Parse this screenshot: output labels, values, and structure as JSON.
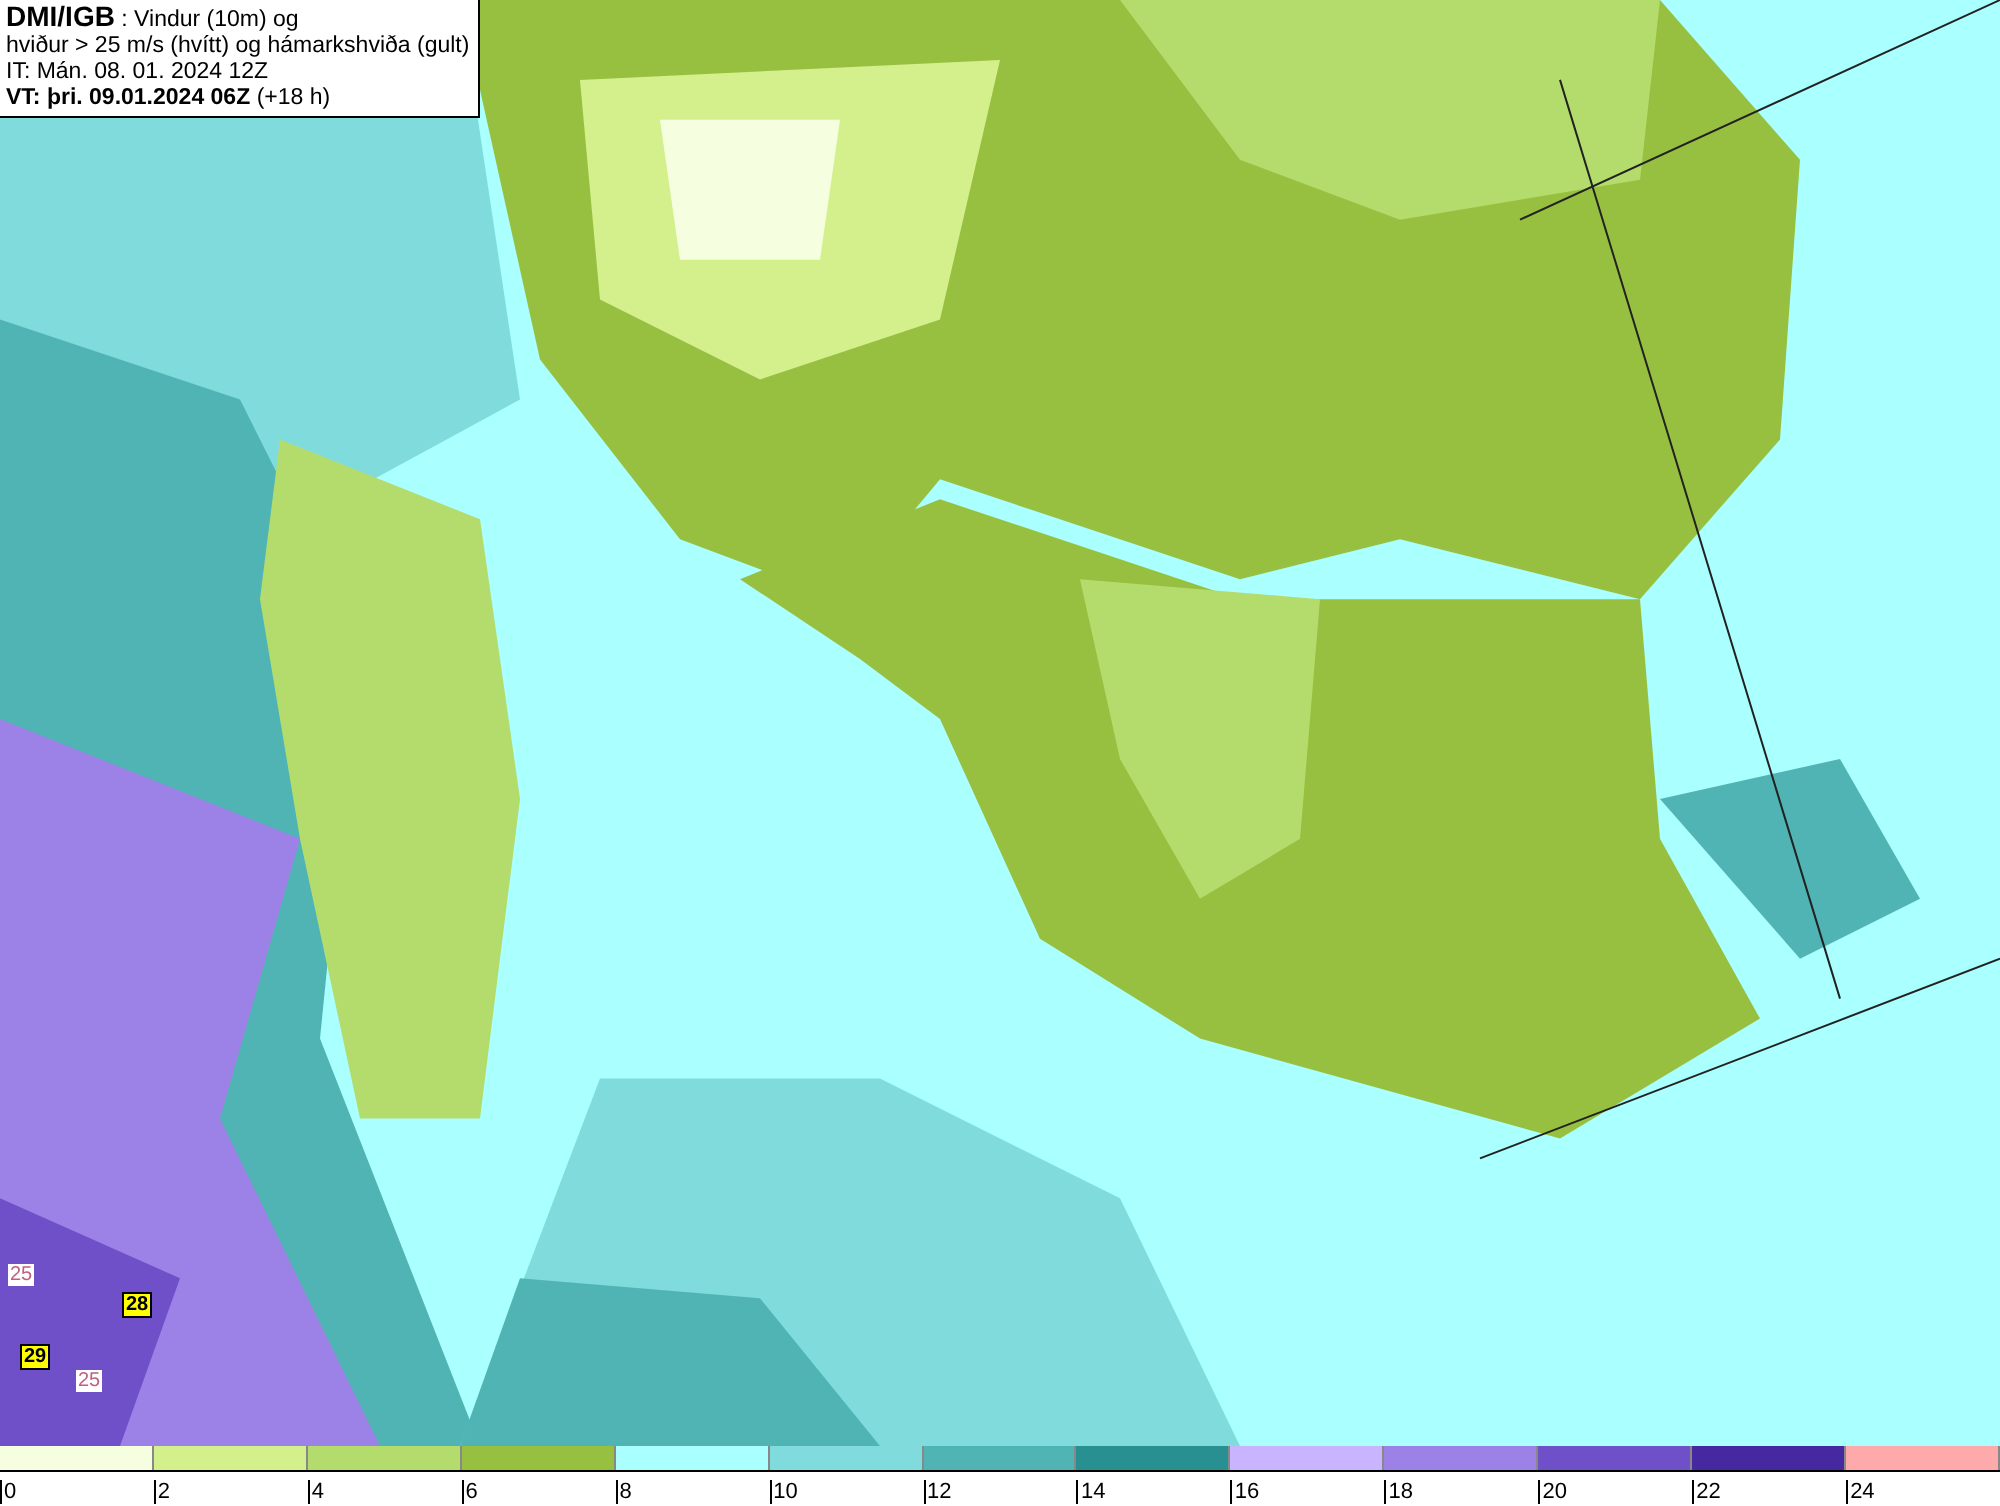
{
  "header": {
    "source": "DMI/IGB",
    "title_rest": ": Vindur (10m) og",
    "line2": "hviður > 25 m/s (hvítt) og hámarkshviða (gult)",
    "line3": "IT: Mán. 08. 01. 2024 12Z",
    "valid": "VT: þri. 09.01.2024 06Z",
    "lead": "(+18 h)"
  },
  "map": {
    "labels": [
      {
        "text": "25",
        "kind": "gust"
      },
      {
        "text": "28",
        "kind": "max"
      },
      {
        "text": "29",
        "kind": "max"
      },
      {
        "text": "25",
        "kind": "gust"
      }
    ]
  },
  "colorbar": {
    "bins": [
      {
        "color": "#f5ffe0"
      },
      {
        "color": "#d4f08c"
      },
      {
        "color": "#b4dc6c"
      },
      {
        "color": "#98c040"
      },
      {
        "color": "#aaffff"
      },
      {
        "color": "#80dcdc"
      },
      {
        "color": "#50b4b4"
      },
      {
        "color": "#289090"
      },
      {
        "color": "#c8b4ff"
      },
      {
        "color": "#9c82e6"
      },
      {
        "color": "#7050c8"
      },
      {
        "color": "#4628a0"
      },
      {
        "color": "#ffaaaa"
      }
    ],
    "ticks": [
      "0",
      "2",
      "4",
      "6",
      "8",
      "10",
      "12",
      "14",
      "16",
      "18",
      "20",
      "22",
      "24"
    ]
  }
}
